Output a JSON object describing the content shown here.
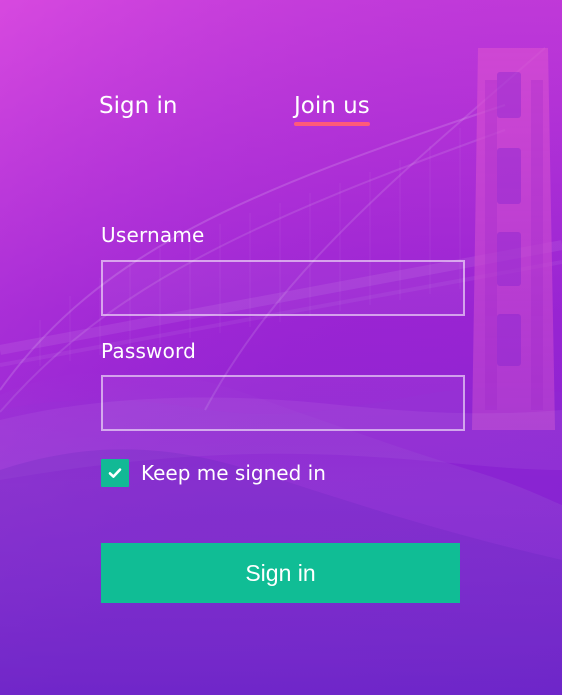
{
  "tabs": {
    "sign_in_label": "Sign in",
    "join_us_label": "Join us",
    "active_tab": "Join us"
  },
  "form": {
    "username_label": "Username",
    "username_value": "",
    "password_label": "Password",
    "password_value": "",
    "keep_signed_in_label": "Keep me signed in",
    "keep_signed_in_checked": true,
    "submit_label": "Sign in"
  },
  "icons": {
    "checkbox_icon": "check-icon"
  },
  "colors": {
    "background_top": "#c33ad8",
    "background_bottom": "#7a1fd1",
    "tab_underline": "#ff5a79",
    "accent_green": "#10bd95",
    "text": "#ffffff"
  }
}
